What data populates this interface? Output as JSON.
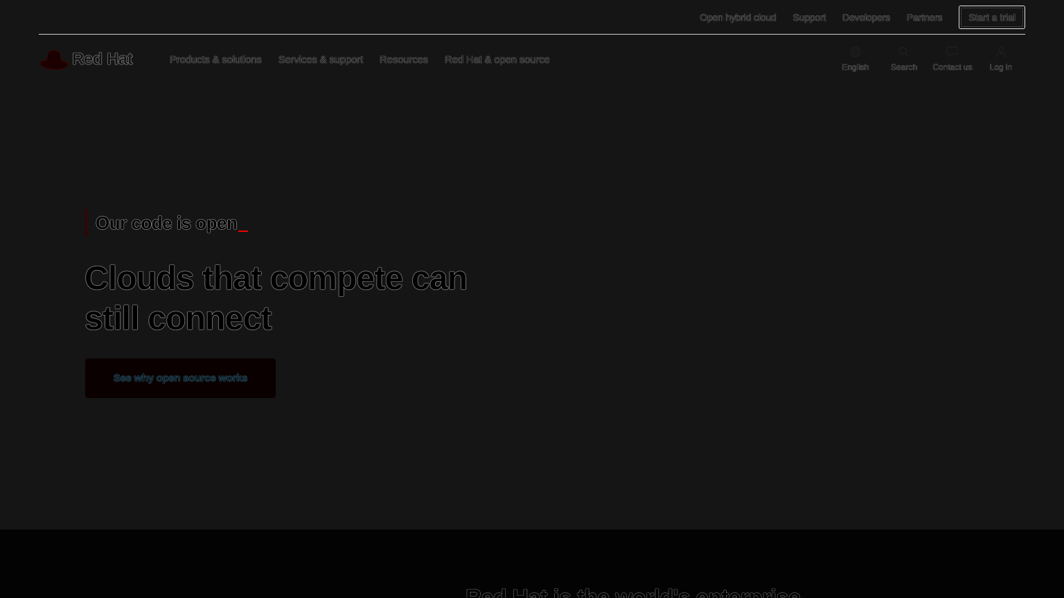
{
  "utility": {
    "links": [
      "Open hybrid cloud",
      "Support",
      "Developers",
      "Partners"
    ],
    "trial_label": "Start a trial"
  },
  "brand": {
    "name": "Red Hat",
    "accent": "#ee0000"
  },
  "nav": {
    "links": [
      "Products & solutions",
      "Services & support",
      "Resources",
      "Red Hat & open source"
    ],
    "tools": {
      "language": {
        "label": "English",
        "icon": "globe-icon"
      },
      "search": {
        "label": "Search",
        "icon": "search-icon"
      },
      "contact": {
        "label": "Contact us",
        "icon": "chat-icon"
      },
      "login": {
        "label": "Log in",
        "icon": "user-icon"
      }
    }
  },
  "hero": {
    "eyebrow": "Our code is open",
    "title": "Clouds that compete can still connect",
    "cta_label": "See why open source works"
  },
  "next_section": {
    "heading": "Red Hat is the world's enterprise"
  }
}
